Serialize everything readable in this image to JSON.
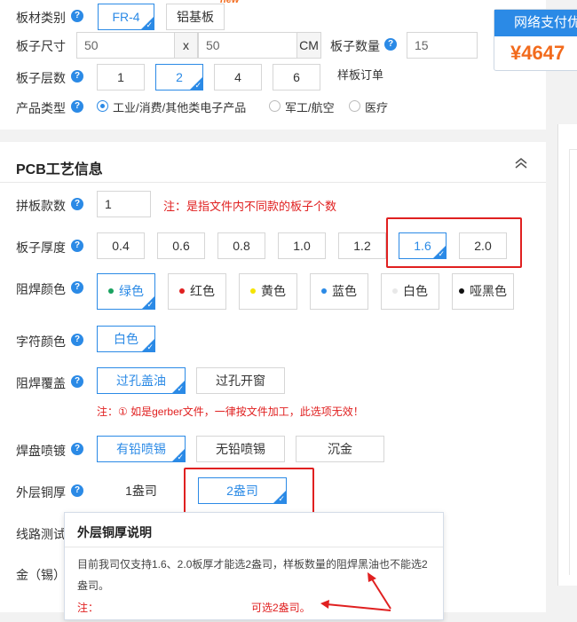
{
  "top": {
    "board_type": {
      "label": "板材类别",
      "options": [
        "FR-4",
        "铝基板"
      ],
      "badge": "new"
    },
    "board_size": {
      "label": "板子尺寸",
      "width": "50",
      "sep": "x",
      "height": "50",
      "unit": "CM"
    },
    "board_qty": {
      "label": "板子数量",
      "value": "15"
    },
    "layers": {
      "label": "板子层数",
      "options": [
        "1",
        "2",
        "4",
        "6"
      ],
      "sample_order": "样板订单"
    },
    "product_type": {
      "label": "产品类型",
      "options": [
        "工业/消费/其他类电子产品",
        "军工/航空",
        "医疗"
      ]
    }
  },
  "payment": {
    "title": "网络支付优",
    "price": "¥4647"
  },
  "pcb": {
    "title": "PCB工艺信息",
    "panel_count": {
      "label": "拼板款数",
      "value": "1",
      "note": "注：是指文件内不同款的板子个数"
    },
    "thickness": {
      "label": "板子厚度",
      "options": [
        "0.4",
        "0.6",
        "0.8",
        "1.0",
        "1.2",
        "1.6",
        "2.0"
      ]
    },
    "mask_color": {
      "label": "阻焊颜色",
      "options": [
        "绿色",
        "红色",
        "黄色",
        "蓝色",
        "白色",
        "哑黑色"
      ]
    },
    "silk_color": {
      "label": "字符颜色",
      "options": [
        "白色"
      ]
    },
    "mask_cover": {
      "label": "阻焊覆盖",
      "options": [
        "过孔盖油",
        "过孔开窗"
      ],
      "note": "注：① 如是gerber文件，一律按文件加工，此选项无效！"
    },
    "surface": {
      "label": "焊盘喷镀",
      "options": [
        "有铅喷锡",
        "无铅喷锡",
        "沉金"
      ]
    },
    "copper": {
      "label": "外层铜厚",
      "options": [
        "1盎司",
        "2盎司"
      ]
    },
    "line_test": {
      "label": "线路测试"
    },
    "gold": {
      "label": "金（锡）"
    }
  },
  "tooltip": {
    "title": "外层铜厚说明",
    "body": "目前我司仅支持1.6、2.0板厚才能选2盎司，样板数量的阻焊黑油也不能选2盎司。",
    "note": "注：",
    "note2": "可选2盎司。"
  },
  "colors": {
    "accent": "#2b8ae6",
    "alert": "#e02020",
    "price": "#f26b1d"
  }
}
